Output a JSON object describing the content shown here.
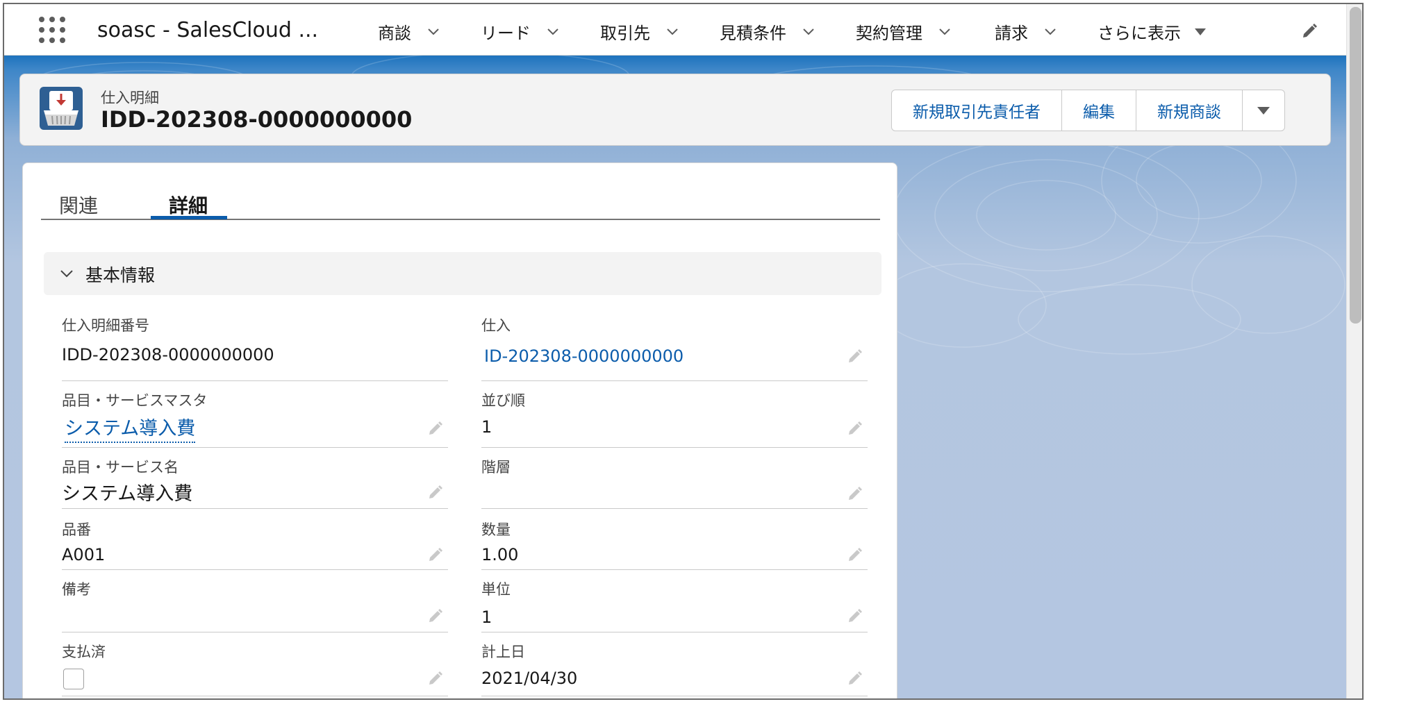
{
  "app": {
    "name": "soasc - SalesCloud ...",
    "nav": [
      {
        "label": "商談",
        "indicator": "chevron"
      },
      {
        "label": "リード",
        "indicator": "chevron"
      },
      {
        "label": "取引先",
        "indicator": "chevron"
      },
      {
        "label": "見積条件",
        "indicator": "chevron"
      },
      {
        "label": "契約管理",
        "indicator": "chevron"
      },
      {
        "label": "請求",
        "indicator": "chevron"
      },
      {
        "label": "さらに表示",
        "indicator": "caret"
      }
    ]
  },
  "record": {
    "object_label": "仕入明細",
    "name": "IDD-202308-0000000000",
    "icon": "basket-download-icon",
    "icon_color": "#2e5f93",
    "actions": [
      "新規取引先責任者",
      "編集",
      "新規商談"
    ]
  },
  "tabs": [
    {
      "label": "関連",
      "active": false
    },
    {
      "label": "詳細",
      "active": true
    }
  ],
  "section": {
    "title": "基本情報"
  },
  "fields": {
    "left": [
      {
        "label": "仕入明細番号",
        "value": "IDD-202308-0000000000",
        "style": "plain",
        "editable": false
      },
      {
        "label": "品目・サービスマスタ",
        "value": "システム導入費",
        "style": "lookup",
        "editable": true
      },
      {
        "label": "品目・サービス名",
        "value": "システム導入費",
        "style": "big",
        "editable": true
      },
      {
        "label": "品番",
        "value": "A001",
        "style": "plain",
        "editable": true
      },
      {
        "label": "備考",
        "value": "",
        "style": "plain",
        "editable": true
      },
      {
        "label": "支払済",
        "value": "",
        "style": "checkbox",
        "checked": false,
        "editable": true
      }
    ],
    "right": [
      {
        "label": "仕入",
        "value": "ID-202308-0000000000",
        "style": "link",
        "editable": true
      },
      {
        "label": "並び順",
        "value": "1",
        "style": "plain",
        "editable": true
      },
      {
        "label": "階層",
        "value": "",
        "style": "plain",
        "editable": true
      },
      {
        "label": "数量",
        "value": "1.00",
        "style": "plain",
        "editable": true
      },
      {
        "label": "単位",
        "value": "1",
        "style": "plain",
        "editable": true
      },
      {
        "label": "計上日",
        "value": "2021/04/30",
        "style": "plain",
        "editable": true
      }
    ]
  },
  "colors": {
    "brand": "#1d72bd",
    "link": "#0b5cab",
    "text": "#181818",
    "label": "#444444"
  }
}
